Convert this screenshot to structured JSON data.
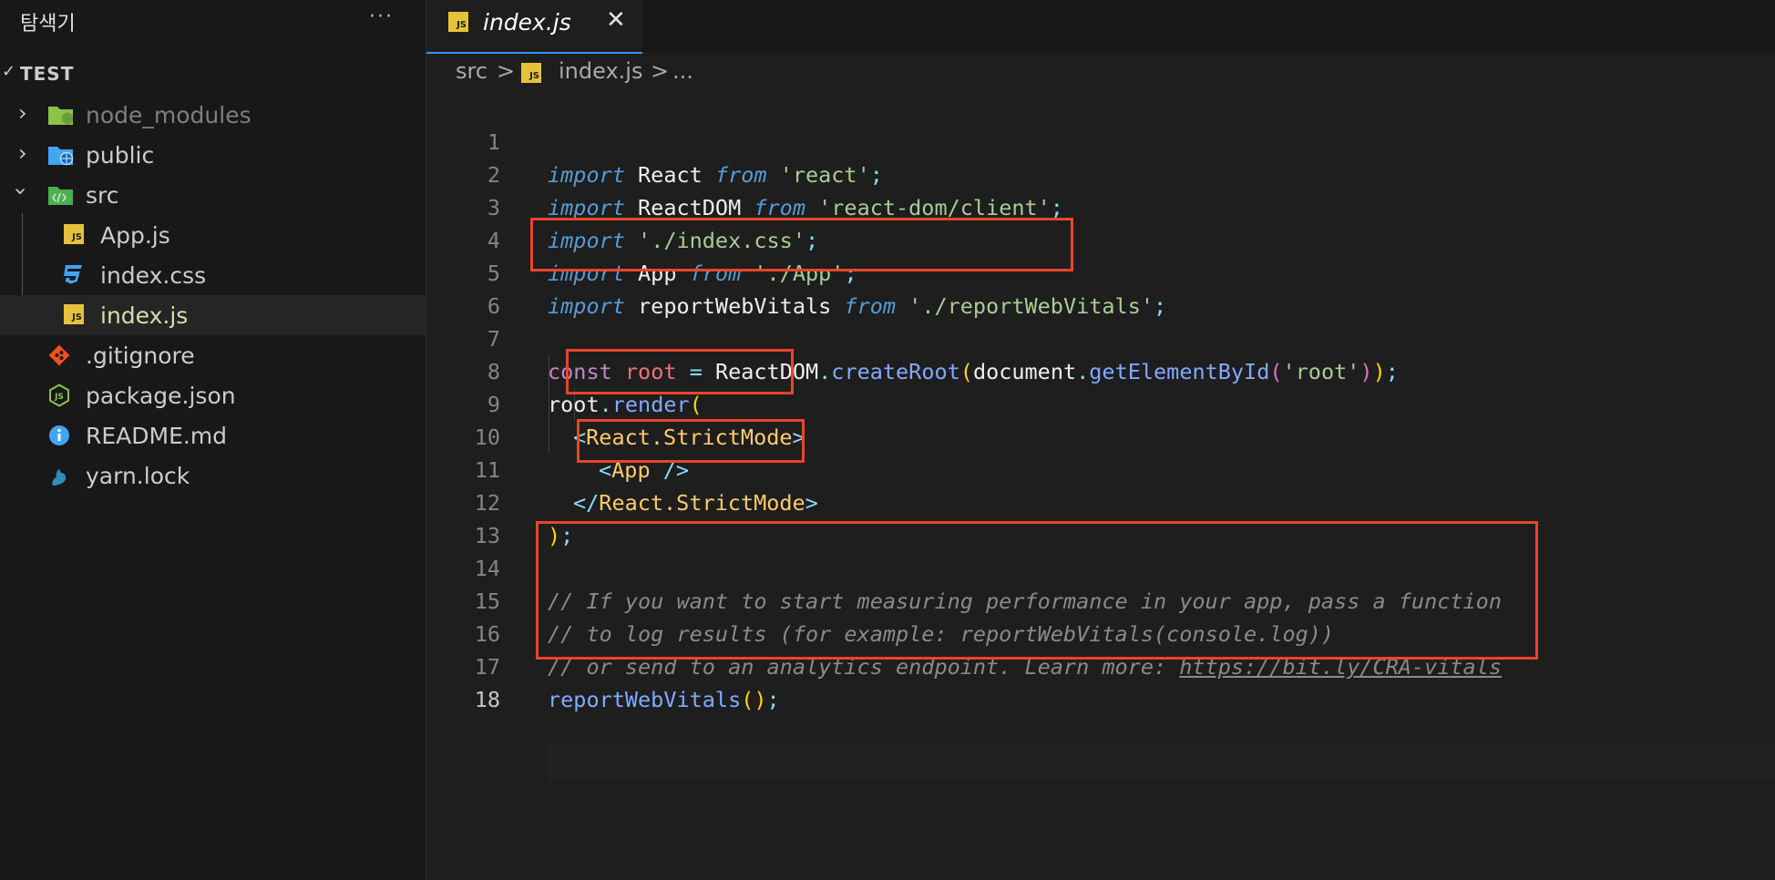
{
  "explorer": {
    "title": "탐색기",
    "more": "···",
    "root_label": "TEST",
    "items": [
      {
        "label": "node_modules",
        "icon": "folder-node-icon"
      },
      {
        "label": "public",
        "icon": "folder-public-icon"
      },
      {
        "label": "src",
        "icon": "folder-src-icon"
      },
      {
        "label": "App.js",
        "icon": "js-file-icon"
      },
      {
        "label": "index.css",
        "icon": "css-file-icon"
      },
      {
        "label": "index.js",
        "icon": "js-file-icon"
      },
      {
        "label": ".gitignore",
        "icon": "git-icon"
      },
      {
        "label": "package.json",
        "icon": "nodejs-icon"
      },
      {
        "label": "README.md",
        "icon": "info-icon"
      },
      {
        "label": "yarn.lock",
        "icon": "yarn-icon"
      }
    ]
  },
  "tab": {
    "name": "index.js",
    "close": "✕",
    "badge": "JS"
  },
  "breadcrumb": {
    "folder": "src",
    "sep": ">",
    "file": "index.js",
    "ellipsis": "..."
  },
  "code": {
    "line_numbers": [
      "1",
      "2",
      "3",
      "4",
      "5",
      "6",
      "7",
      "8",
      "9",
      "10",
      "11",
      "12",
      "13",
      "14",
      "15",
      "16",
      "17",
      "18"
    ],
    "l1": {
      "a": "import",
      "b": " React ",
      "c": "from",
      "d": " ",
      "e": "'react'",
      "f": ";"
    },
    "l2": {
      "a": "import",
      "b": " ReactDOM ",
      "c": "from",
      "d": " ",
      "e": "'react-dom/client'",
      "f": ";"
    },
    "l3": {
      "a": "import",
      "b": " ",
      "e": "'./index.css'",
      "f": ";"
    },
    "l4": {
      "a": "import",
      "b": " App ",
      "c": "from",
      "d": " ",
      "e": "'./App'",
      "f": ";"
    },
    "l5": {
      "a": "import",
      "b": " reportWebVitals ",
      "c": "from",
      "d": " ",
      "e": "'./reportWebVitals'",
      "f": ";"
    },
    "l7": {
      "a": "const",
      "b": " ",
      "c": "root",
      "d": " = ",
      "e": "ReactDOM",
      "f": ".",
      "g": "createRoot",
      "h": "(",
      "i": "document",
      "j": ".",
      "k": "getElementById",
      "l": "(",
      "m": "'root'",
      "n": ")",
      "o": ")",
      "p": ";"
    },
    "l8": {
      "a": "root",
      "b": ".",
      "c": "render",
      "d": "("
    },
    "l9": {
      "a": "<",
      "b": "React.StrictMode",
      "c": ">"
    },
    "l10": {
      "a": "<",
      "b": "App",
      "c": " />"
    },
    "l11": {
      "a": "</",
      "b": "React.StrictMode",
      "c": ">"
    },
    "l12": {
      "a": ")",
      "b": ";"
    },
    "l14": "// If you want to start measuring performance in your app, pass a function",
    "l15": "// to log results (for example: reportWebVitals(console.log))",
    "l16": {
      "a": "// or send to an analytics endpoint. Learn more: ",
      "b": "https://bit.ly/CRA-vitals"
    },
    "l17": {
      "a": "reportWebVitals",
      "b": "(",
      "c": ")",
      "d": ";"
    }
  },
  "colors": {
    "highlight_box": "#e8452c",
    "tab_accent": "#3794ff"
  }
}
